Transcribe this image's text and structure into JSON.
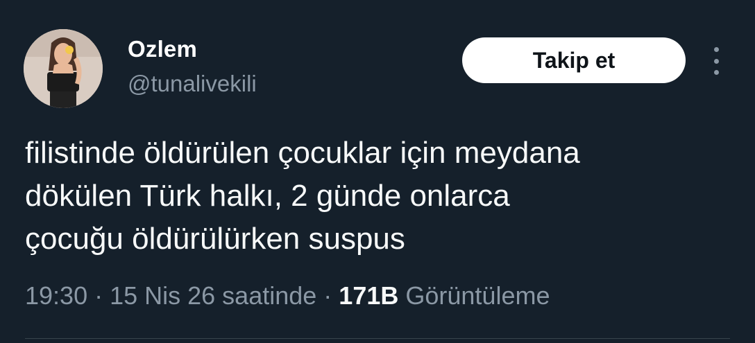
{
  "user": {
    "display_name": "Ozlem",
    "handle": "@tunalivekili"
  },
  "actions": {
    "follow_label": "Takip et",
    "more_icon": "more-vertical-icon"
  },
  "tweet": {
    "lines": [
      "filistinde öldürülen çocuklar için meydana",
      "dökülen Türk halkı, 2 günde onlarca",
      "çocuğu öldürülürken suspus"
    ]
  },
  "meta": {
    "time": "19:30",
    "separator": " · ",
    "date": "15 Nis 26 saatinde",
    "views_count": "171B",
    "views_label": "Görüntüleme"
  },
  "colors": {
    "background": "#15202b",
    "text_primary": "#f7f9f9",
    "text_secondary": "#8b98a5",
    "button_bg": "#ffffff"
  }
}
